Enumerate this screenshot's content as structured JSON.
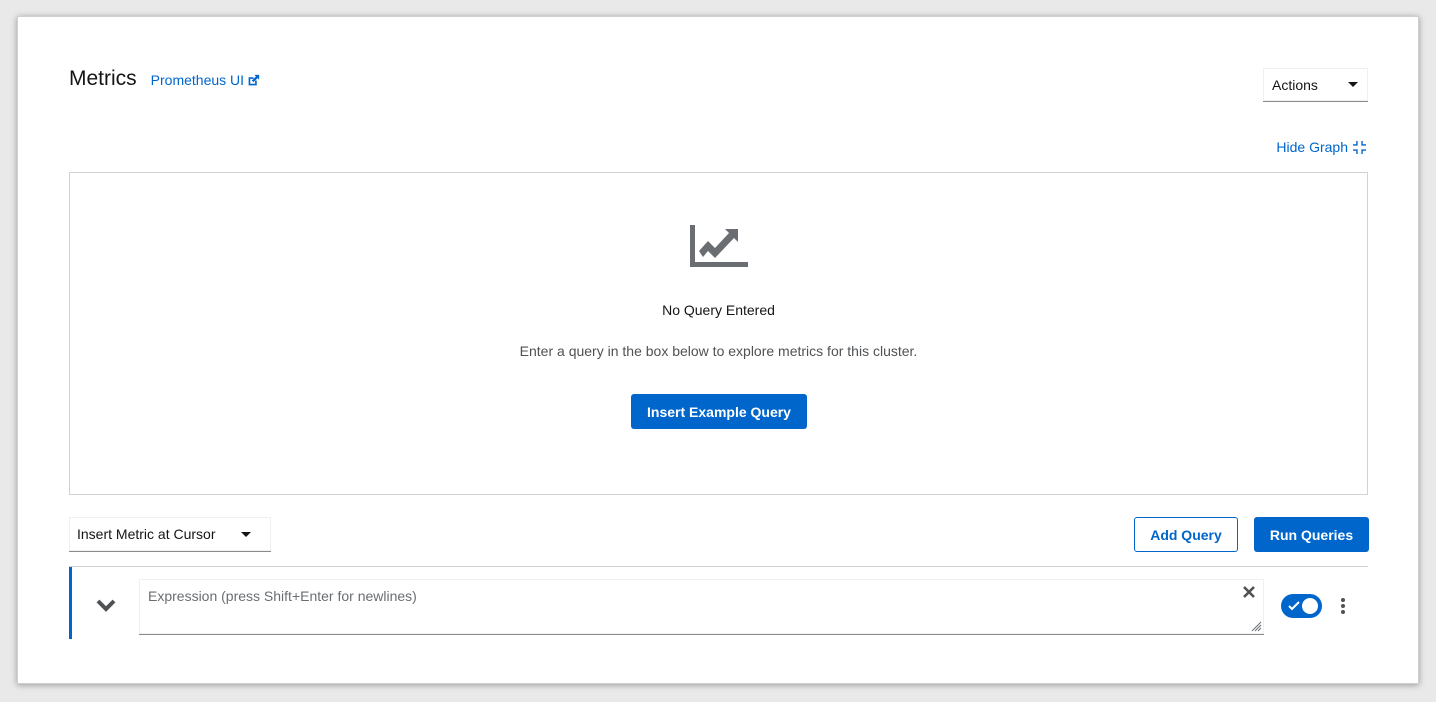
{
  "header": {
    "title": "Metrics",
    "prometheus_link": "Prometheus UI",
    "actions_label": "Actions",
    "hide_graph_label": "Hide Graph"
  },
  "graph": {
    "empty_title": "No Query Entered",
    "empty_body": "Enter a query in the box below to explore metrics for this cluster.",
    "example_button": "Insert Example Query",
    "icon": "chart-line-icon"
  },
  "toolbar": {
    "insert_metric_label": "Insert Metric at Cursor",
    "add_query_label": "Add Query",
    "run_queries_label": "Run Queries"
  },
  "query": {
    "placeholder": "Expression (press Shift+Enter for newlines)",
    "value": "",
    "enabled": true
  },
  "colors": {
    "accent": "#0066cc",
    "text": "#151515",
    "muted": "#6a6e73",
    "icon_gray": "#6a6e73"
  }
}
